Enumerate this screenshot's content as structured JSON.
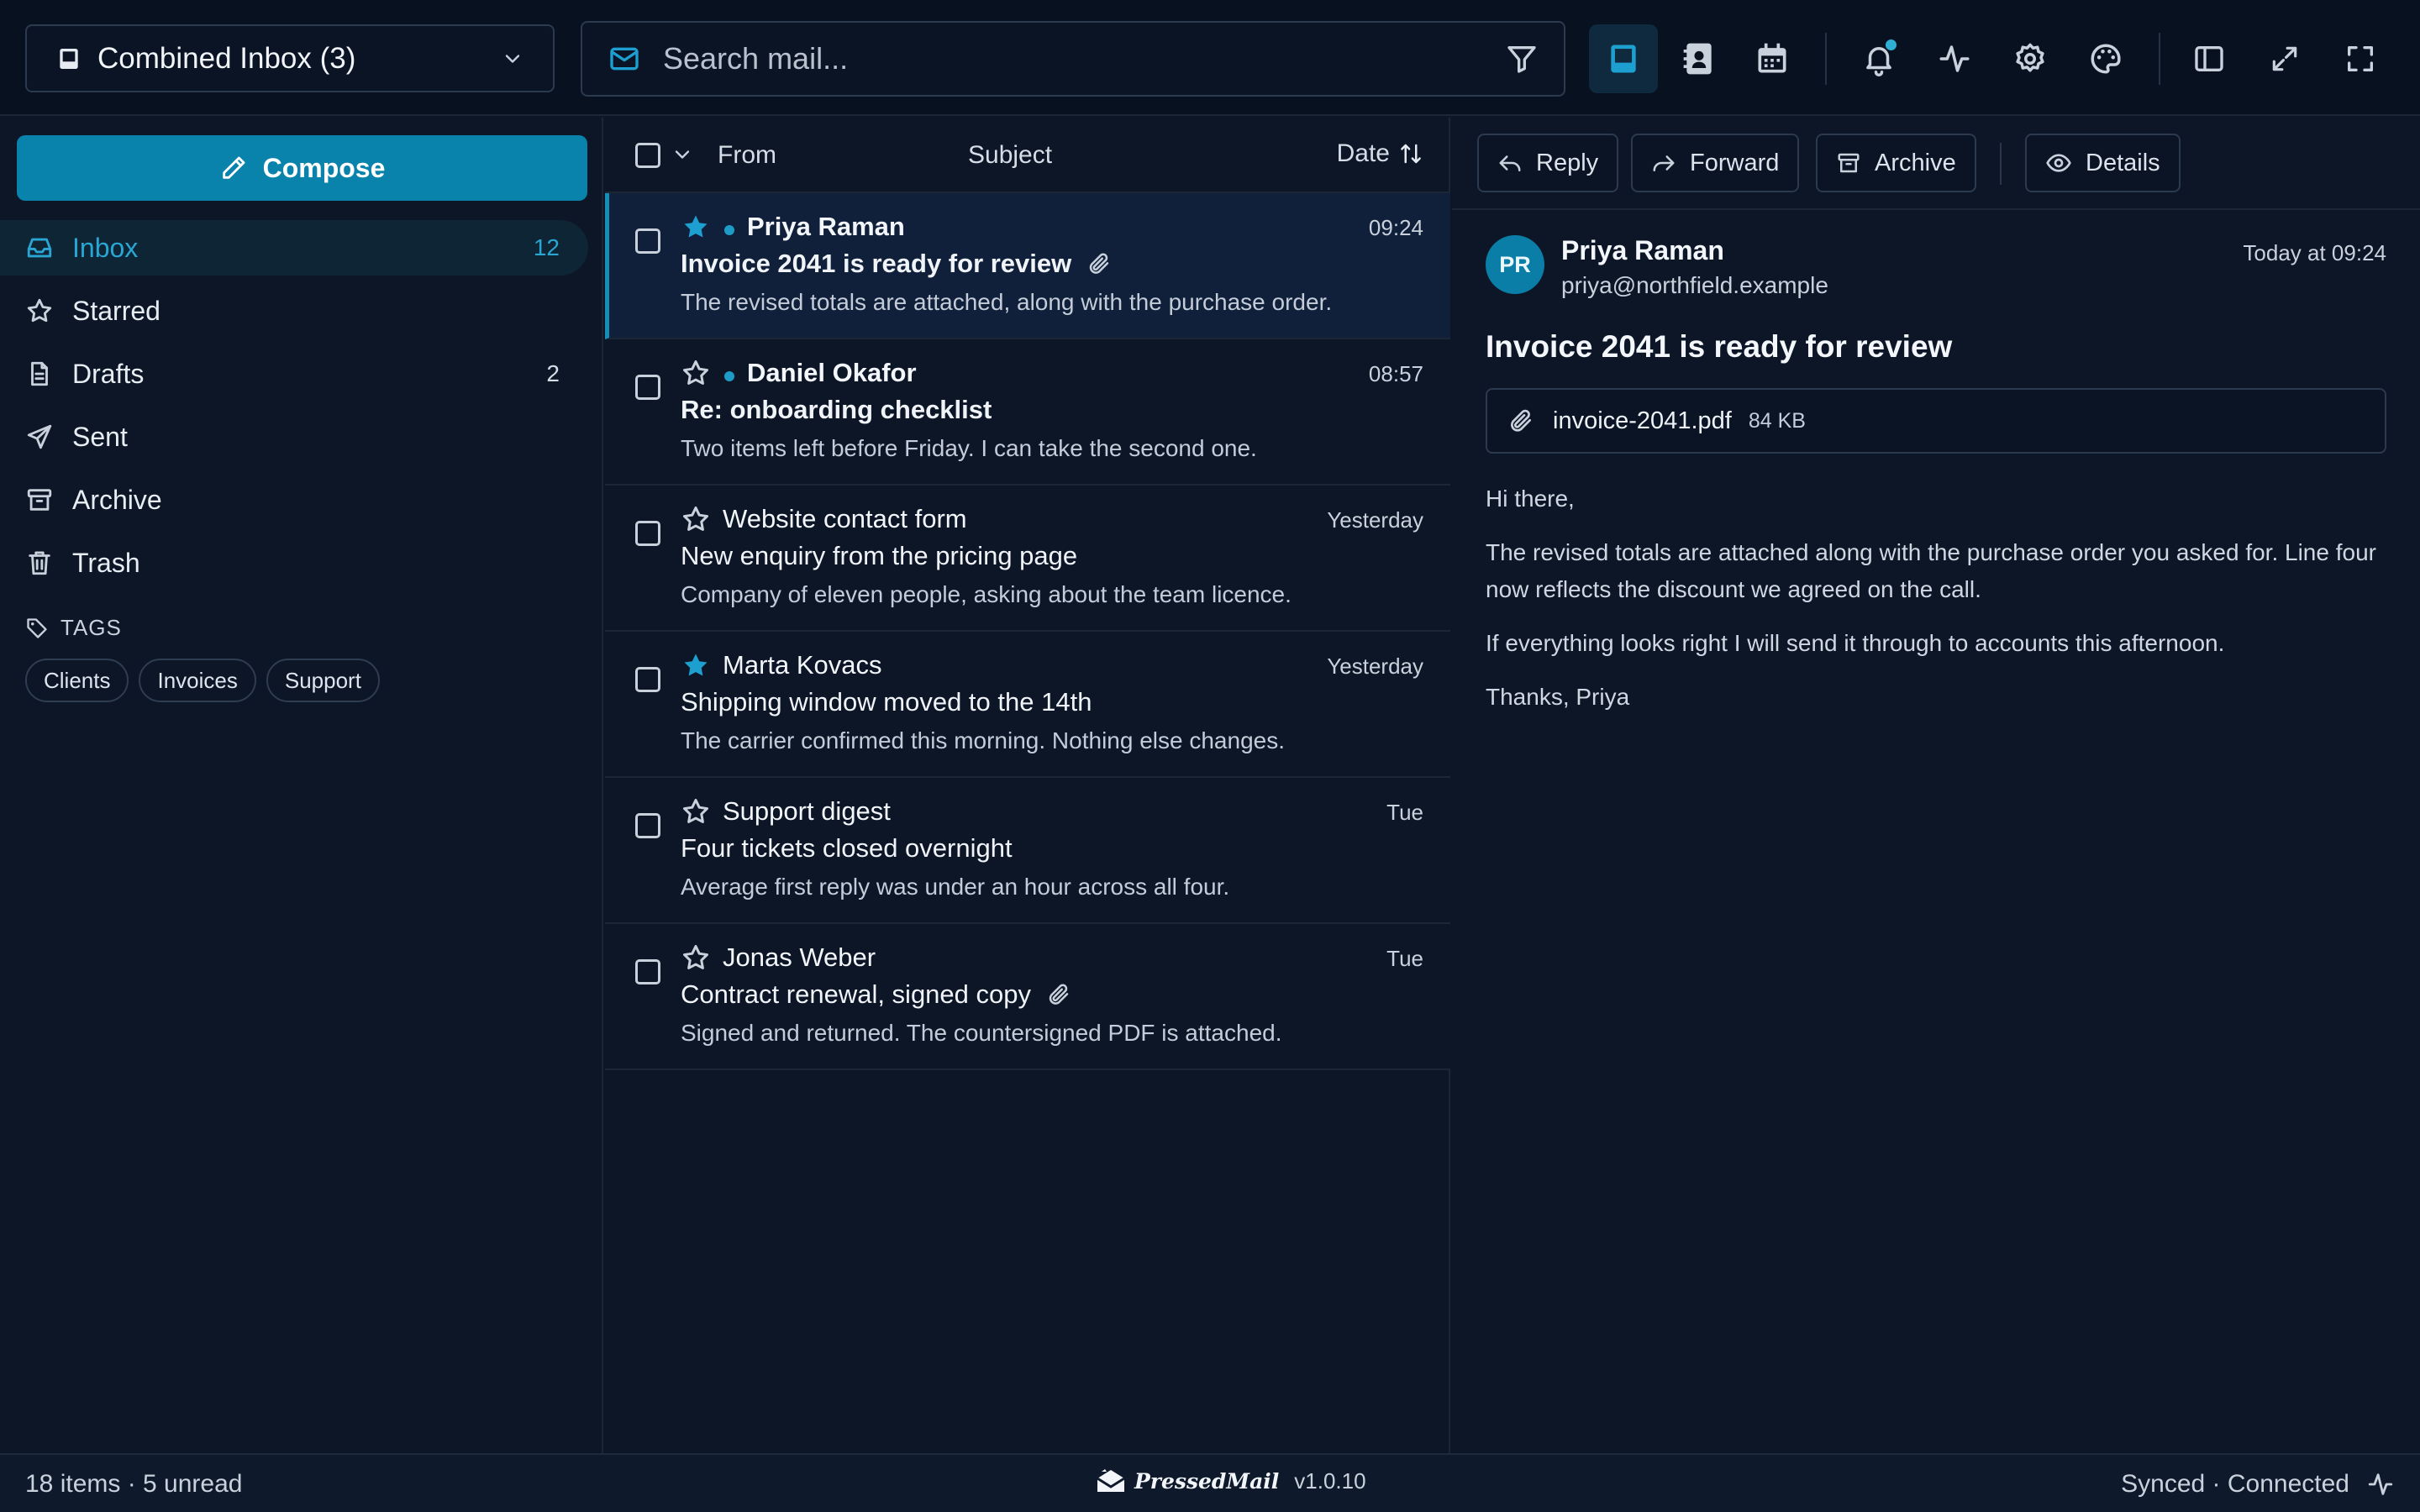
{
  "account": {
    "label": "Combined Inbox (3)"
  },
  "search": {
    "placeholder": "Search mail..."
  },
  "toolbar": {
    "icons": [
      "inbox-icon",
      "contacts-icon",
      "calendar-icon",
      "bell-icon",
      "activity-icon",
      "gear-icon",
      "palette-icon",
      "sidebar-toggle-icon",
      "expand-icon",
      "fullscreen-icon"
    ],
    "active_view": "inbox",
    "accent": "#2eb0d4"
  },
  "sidebar": {
    "compose_label": "Compose",
    "folders": [
      {
        "label": "Inbox",
        "count": "12",
        "icon": "inbox-icon",
        "active": true
      },
      {
        "label": "Starred",
        "count": "",
        "icon": "star-icon"
      },
      {
        "label": "Drafts",
        "count": "2",
        "icon": "file-icon"
      },
      {
        "label": "Sent",
        "count": "",
        "icon": "send-icon"
      },
      {
        "label": "Archive",
        "count": "",
        "icon": "archive-icon"
      },
      {
        "label": "Trash",
        "count": "",
        "icon": "trash-icon"
      }
    ],
    "tags_title": "TAGS",
    "tags": [
      "Clients",
      "Invoices",
      "Support"
    ]
  },
  "list": {
    "headers": {
      "from": "From",
      "subject": "Subject",
      "date": "Date"
    },
    "messages": [
      {
        "from": "Priya Raman",
        "date": "09:24",
        "subject": "Invoice 2041 is ready for review",
        "preview": "The revised totals are attached, along with the purchase order.",
        "starred": true,
        "unread": true,
        "attachment": true,
        "selected": true
      },
      {
        "from": "Daniel Okafor",
        "date": "08:57",
        "subject": "Re: onboarding checklist",
        "preview": "Two items left before Friday. I can take the second one.",
        "starred": false,
        "unread": true,
        "attachment": false
      },
      {
        "from": "Website contact form",
        "date": "Yesterday",
        "subject": "New enquiry from the pricing page",
        "preview": "Company of eleven people, asking about the team licence.",
        "starred": false,
        "unread": false,
        "attachment": false
      },
      {
        "from": "Marta Kovacs",
        "date": "Yesterday",
        "subject": "Shipping window moved to the 14th",
        "preview": "The carrier confirmed this morning. Nothing else changes.",
        "starred": true,
        "unread": false,
        "attachment": false
      },
      {
        "from": "Support digest",
        "date": "Tue",
        "subject": "Four tickets closed overnight",
        "preview": "Average first reply was under an hour across all four.",
        "starred": false,
        "unread": false,
        "attachment": false
      },
      {
        "from": "Jonas Weber",
        "date": "Tue",
        "subject": "Contract renewal, signed copy",
        "preview": "Signed and returned. The countersigned PDF is attached.",
        "starred": false,
        "unread": false,
        "attachment": true
      }
    ]
  },
  "reader": {
    "actions": {
      "reply": "Reply",
      "forward": "Forward",
      "archive": "Archive",
      "details": "Details"
    },
    "avatar": "PR",
    "sender_name": "Priya Raman",
    "sender_email": "priya@northfield.example",
    "date": "Today at 09:24",
    "subject": "Invoice 2041 is ready for review",
    "attachment": {
      "name": "invoice-2041.pdf",
      "size": "84 KB"
    },
    "body": [
      "Hi there,",
      "The revised totals are attached along with the purchase order you asked for. Line four now reflects the discount we agreed on the call.",
      "If everything looks right I will send it through to accounts this afternoon.",
      "Thanks, Priya"
    ]
  },
  "status": {
    "left": "18 items · 5 unread",
    "brand": "PressedMail",
    "version": "v1.0.10",
    "right": "Synced · Connected"
  }
}
